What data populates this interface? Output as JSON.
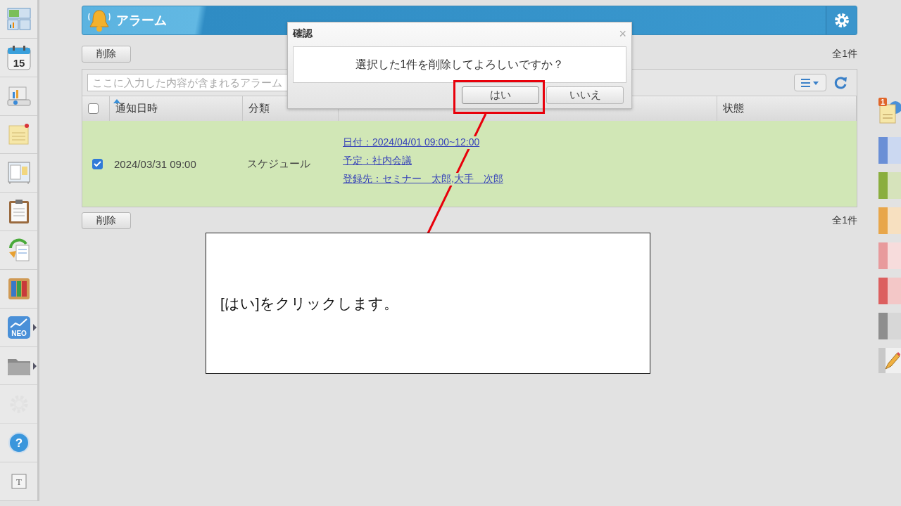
{
  "sidebar": {
    "items": [
      {
        "kind": "dashboard",
        "submenu": false,
        "disabled": false
      },
      {
        "kind": "calendar",
        "label": "15",
        "submenu": false,
        "disabled": false
      },
      {
        "kind": "facility",
        "submenu": false,
        "disabled": false
      },
      {
        "kind": "memo",
        "submenu": false,
        "disabled": false
      },
      {
        "kind": "board",
        "submenu": false,
        "disabled": false
      },
      {
        "kind": "report",
        "submenu": false,
        "disabled": false
      },
      {
        "kind": "workflow",
        "submenu": false,
        "disabled": false
      },
      {
        "kind": "cabinet",
        "submenu": false,
        "disabled": false
      },
      {
        "kind": "neo",
        "label": "NEO",
        "submenu": true,
        "disabled": false
      },
      {
        "kind": "folder",
        "submenu": true,
        "disabled": false
      },
      {
        "kind": "settings",
        "submenu": false,
        "disabled": true
      },
      {
        "kind": "help",
        "label": "?",
        "submenu": false,
        "disabled": false
      },
      {
        "kind": "text",
        "label": "T",
        "submenu": false,
        "disabled": false
      }
    ]
  },
  "header": {
    "title": "アラーム"
  },
  "toolbar_top": {
    "delete_button": "削除",
    "count": "全1件"
  },
  "search": {
    "placeholder": "ここに入力した内容が含まれるアラーム"
  },
  "table": {
    "select_all": {
      "checked": false
    },
    "columns": [
      {
        "label": "通知日時",
        "sorted": true
      },
      {
        "label": "分類",
        "sorted": false
      },
      {
        "sorted": false
      },
      {
        "label": "状態",
        "sorted": false
      }
    ],
    "rows": [
      {
        "selected": true,
        "datetime": "2024/03/31 09:00",
        "category": "スケジュール",
        "details": [
          "日付：2024/04/01 09:00~12:00",
          "予定：社内会議",
          "登録先：セミナー　太郎,大手　次郎"
        ],
        "status": ""
      }
    ]
  },
  "toolbar_bottom": {
    "delete_button": "削除",
    "count": "全1件"
  },
  "right_panel": {
    "items": [
      {
        "kind": "notes",
        "badge": "1"
      },
      {
        "kind": "color",
        "color": "#6a8fd6"
      },
      {
        "kind": "color",
        "color": "#8aae3e"
      },
      {
        "kind": "color",
        "color": "#e8a64a"
      },
      {
        "kind": "color",
        "color": "#e89a9c"
      },
      {
        "kind": "color",
        "color": "#dc5f5f"
      },
      {
        "kind": "color",
        "color": "#8e8e8e"
      },
      {
        "kind": "pencil"
      }
    ]
  },
  "dialog": {
    "title": "確認",
    "close": "×",
    "message": "選択した1件を削除してよろしいですか？",
    "buttons": [
      {
        "label": "はい",
        "highlighted": true
      },
      {
        "label": "いいえ",
        "highlighted": false
      }
    ]
  },
  "callout": {
    "text": "[はい]をクリックします。"
  }
}
